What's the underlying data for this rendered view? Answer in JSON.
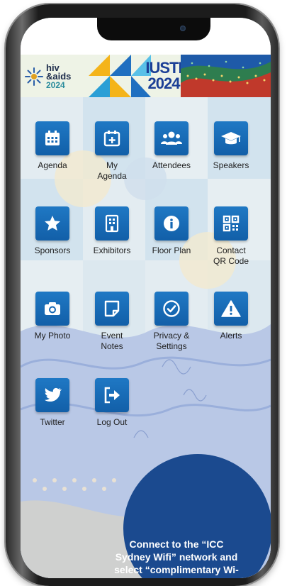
{
  "banner": {
    "hiv_logo": {
      "line1": "hiv",
      "line2": "&aids",
      "line3": "2024"
    },
    "iusti_logo": {
      "line1": "IUSTI",
      "line2": "2024"
    }
  },
  "grid": {
    "tiles": [
      {
        "label": "Agenda",
        "icon": "calendar-grid-icon"
      },
      {
        "label": "My\nAgenda",
        "icon": "calendar-plus-icon"
      },
      {
        "label": "Attendees",
        "icon": "people-group-icon"
      },
      {
        "label": "Speakers",
        "icon": "graduation-cap-icon"
      },
      {
        "label": "Sponsors",
        "icon": "star-icon"
      },
      {
        "label": "Exhibitors",
        "icon": "building-icon"
      },
      {
        "label": "Floor Plan",
        "icon": "info-icon"
      },
      {
        "label": "Contact\nQR Code",
        "icon": "qr-code-icon"
      },
      {
        "label": "My Photo",
        "icon": "camera-icon"
      },
      {
        "label": "Event\nNotes",
        "icon": "sticky-note-icon"
      },
      {
        "label": "Privacy &\nSettings",
        "icon": "check-circle-icon"
      },
      {
        "label": "Alerts",
        "icon": "warning-icon"
      },
      {
        "label": "Twitter",
        "icon": "twitter-bird-icon"
      },
      {
        "label": "Log Out",
        "icon": "logout-icon"
      }
    ]
  },
  "wifi_notice": {
    "line1": "Connect to the “ICC",
    "line2": "Sydney Wifi” network and",
    "line3": "select “complimentary Wi-"
  },
  "colors": {
    "tile_blue": "#1668b4",
    "notice_bubble": "#1b4a8f",
    "background": "#d8e6ee"
  }
}
